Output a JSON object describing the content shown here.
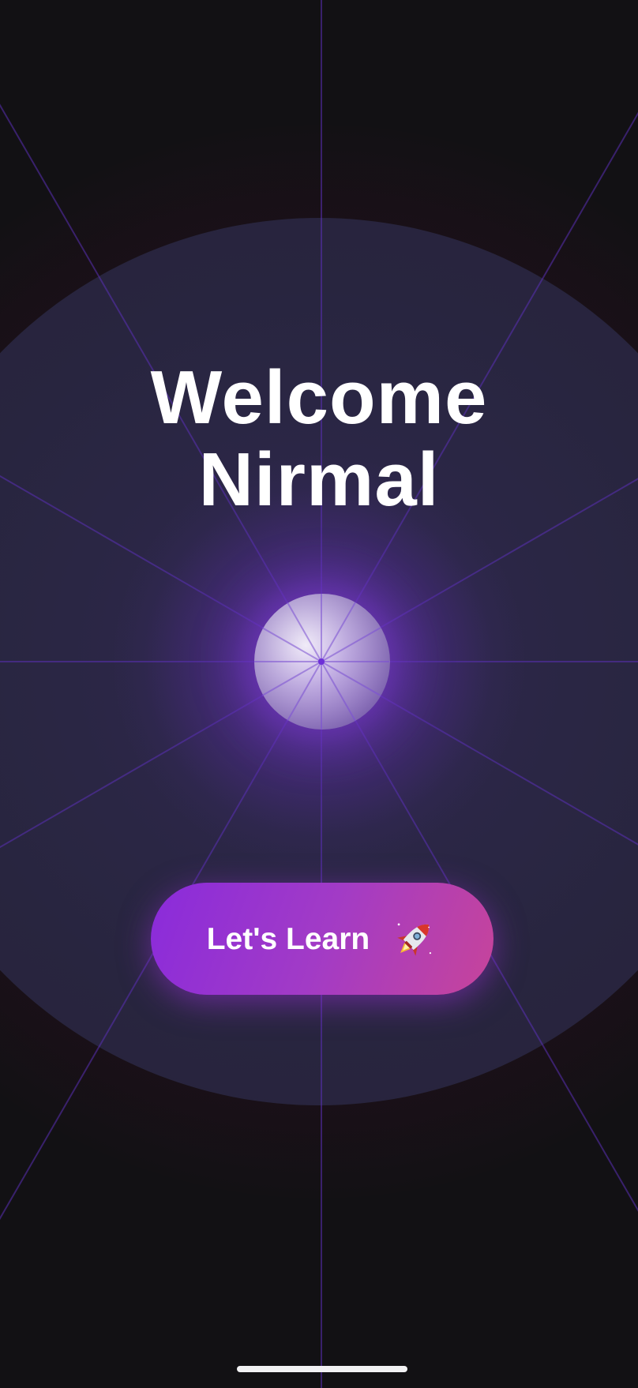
{
  "welcome": {
    "line1": "Welcome",
    "line2": "Nirmal"
  },
  "cta": {
    "label": "Let's Learn",
    "icon": "rocket-icon"
  },
  "colors": {
    "background": "#121114",
    "disc": "#2a2644",
    "ray": "#5a2fb5",
    "button_start": "#8a2bdb",
    "button_end": "#c7449a",
    "text": "#ffffff"
  }
}
